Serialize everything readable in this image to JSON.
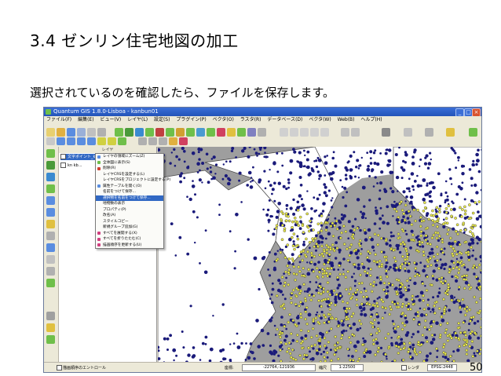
{
  "slide": {
    "title": "3.4 ゼンリン住宅地図の加工",
    "body": "選択されているのを確認したら、ファイルを保存します。",
    "page_number": "50"
  },
  "window": {
    "title": "Quantum GIS 1.8.0-Lisboa - kanbun01",
    "menu": [
      "ファイル(F)",
      "編集(E)",
      "ビュー(V)",
      "レイヤ(L)",
      "設定(S)",
      "プラグイン(P)",
      "ベクタ(O)",
      "ラスタ(R)",
      "データベース(D)",
      "ベクタ(W)",
      "Web(B)",
      "ヘルプ(H)"
    ]
  },
  "layers": {
    "panel_title": "レイヤ",
    "items": [
      {
        "label": "文字ポイント_kanbun01",
        "selected": true
      },
      {
        "label": "kn kb...",
        "selected": false
      }
    ]
  },
  "context_menu": {
    "items": [
      {
        "label": "レイヤの領域にズーム(Z)",
        "highlight": false,
        "icon_color": "#5a8de0"
      },
      {
        "label": "全体図に表示(S)",
        "highlight": false,
        "icon_color": "#6fbf4a"
      },
      {
        "label": "削除(R)",
        "highlight": false,
        "icon_color": "#d04030"
      },
      {
        "label": "レイヤCRSを設定する(L)",
        "highlight": false,
        "icon_color": ""
      },
      {
        "label": "レイヤCRSをプロジェクトに設定する(P)",
        "highlight": false,
        "icon_color": ""
      },
      {
        "label": "属性テーブルを開く(O)",
        "highlight": false,
        "icon_color": "#5a8de0"
      },
      {
        "label": "名前をつけて保存...",
        "highlight": false,
        "icon_color": ""
      },
      {
        "label": "選択物を名前をつけて保存...",
        "highlight": true,
        "icon_color": ""
      },
      {
        "label": "地物数の表示",
        "highlight": false,
        "icon_color": ""
      },
      {
        "label": "プロパティ(P)",
        "highlight": false,
        "icon_color": ""
      },
      {
        "label": "改名(A)",
        "highlight": false,
        "icon_color": ""
      },
      {
        "label": "スタイルコピー",
        "highlight": false,
        "icon_color": ""
      },
      {
        "label": "新規グループ追加(G)",
        "highlight": false,
        "icon_color": ""
      },
      {
        "label": "すべてを展開する(X)",
        "highlight": false,
        "icon_color": "#d04080"
      },
      {
        "label": "すべてを折りたたむ(C)",
        "highlight": false,
        "icon_color": "#d04080"
      },
      {
        "label": "描画順序を更新する(U)",
        "highlight": false,
        "icon_color": "#d04080"
      }
    ]
  },
  "statusbar": {
    "left_label": "描画順序のエントロール",
    "coord_label": "座標:",
    "coordinates": "-22764,-121936",
    "scale_label": "縮尺",
    "scale": "1:22500",
    "render_label": "レンダ",
    "epsg": "EPSG:2448"
  },
  "colors": {
    "dots_blue": "#1a1a7a",
    "dots_yellow": "#e8e84a",
    "map_block_gray": "#9e9e9e",
    "selection_blue": "#3168c4"
  }
}
